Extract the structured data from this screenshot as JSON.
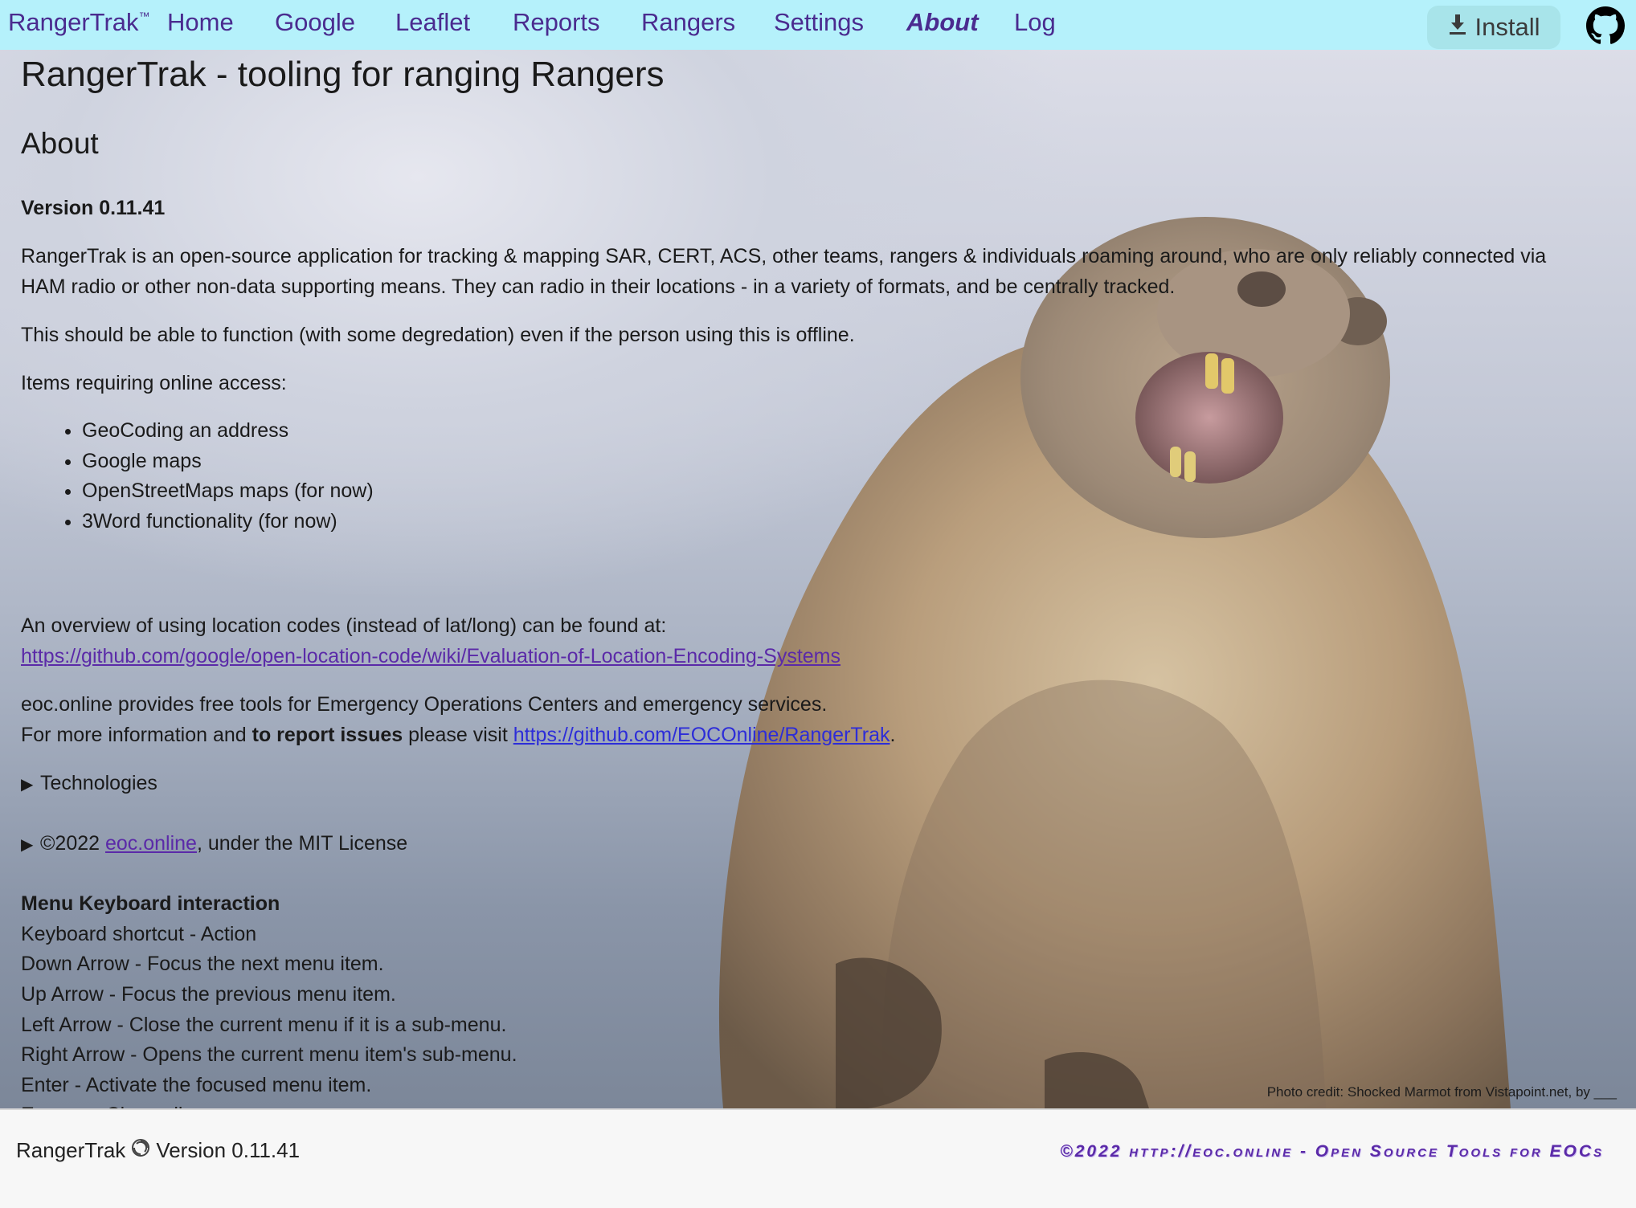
{
  "nav": {
    "brand": "RangerTrak",
    "brand_mark": "™",
    "items": [
      "Home",
      "Google",
      "Leaflet",
      "Reports",
      "Rangers",
      "Settings",
      "About",
      "Log"
    ],
    "active": "About",
    "install_label": "Install"
  },
  "page": {
    "title": "RangerTrak - tooling for ranging Rangers",
    "section": "About",
    "version": "Version 0.11.41",
    "intro_line1": "RangerTrak is an open-source application for tracking & mapping SAR, CERT, ACS, other teams, rangers & individuals roaming around, who are only reliably connected via",
    "intro_line2": "HAM radio or other non-data supporting means. They can radio in their locations - in a variety of formats, and be centrally tracked.",
    "offline": "This should be able to function (with some degredation) even if the person using this is offline.",
    "online_heading": "Items requiring online access:",
    "online_items": [
      "GeoCoding an address",
      "Google maps",
      "OpenStreetMaps maps (for now)",
      "3Word functionality (for now)"
    ],
    "overview": "An overview of using location codes (instead of lat/long) can be found at:",
    "overview_link": "https://github.com/google/open-location-code/wiki/Evaluation-of-Location-Encoding-Systems",
    "eoc_line": "eoc.online provides free tools for Emergency Operations Centers and emergency services.",
    "info_prefix": "For more information and ",
    "info_bold": "to report issues",
    "info_mid": " please visit ",
    "info_link": "https://github.com/EOCOnline/RangerTrak",
    "info_suffix": ".",
    "technologies": "Technologies",
    "copyright_prefix": "©2022 ",
    "copyright_link": "eoc.online",
    "copyright_suffix": ", under the MIT License",
    "keyboard_heading": "Menu Keyboard interaction",
    "keyboard_lines": [
      "Keyboard shortcut - Action",
      "Down Arrow - Focus the next menu item.",
      "Up Arrow - Focus the previous menu item.",
      "Left Arrow - Close the current menu if it is a sub-menu.",
      "Right Arrow - Opens the current menu item's sub-menu.",
      "Enter - Activate the focused menu item.",
      "Escape - Close all open menus."
    ],
    "photo_credit": "Photo credit: Shocked Marmot from Vistapoint.net, by ___"
  },
  "footer": {
    "app": "RangerTrak",
    "version": "Version 0.11.41",
    "right": "©2022 http://eoc.online - Open Source Tools for EOCs"
  },
  "colors": {
    "nav_bg": "#b5f1fb",
    "nav_text": "#4a2b8f",
    "link": "#5b2aa8",
    "link_blue": "#2d2dd8"
  }
}
